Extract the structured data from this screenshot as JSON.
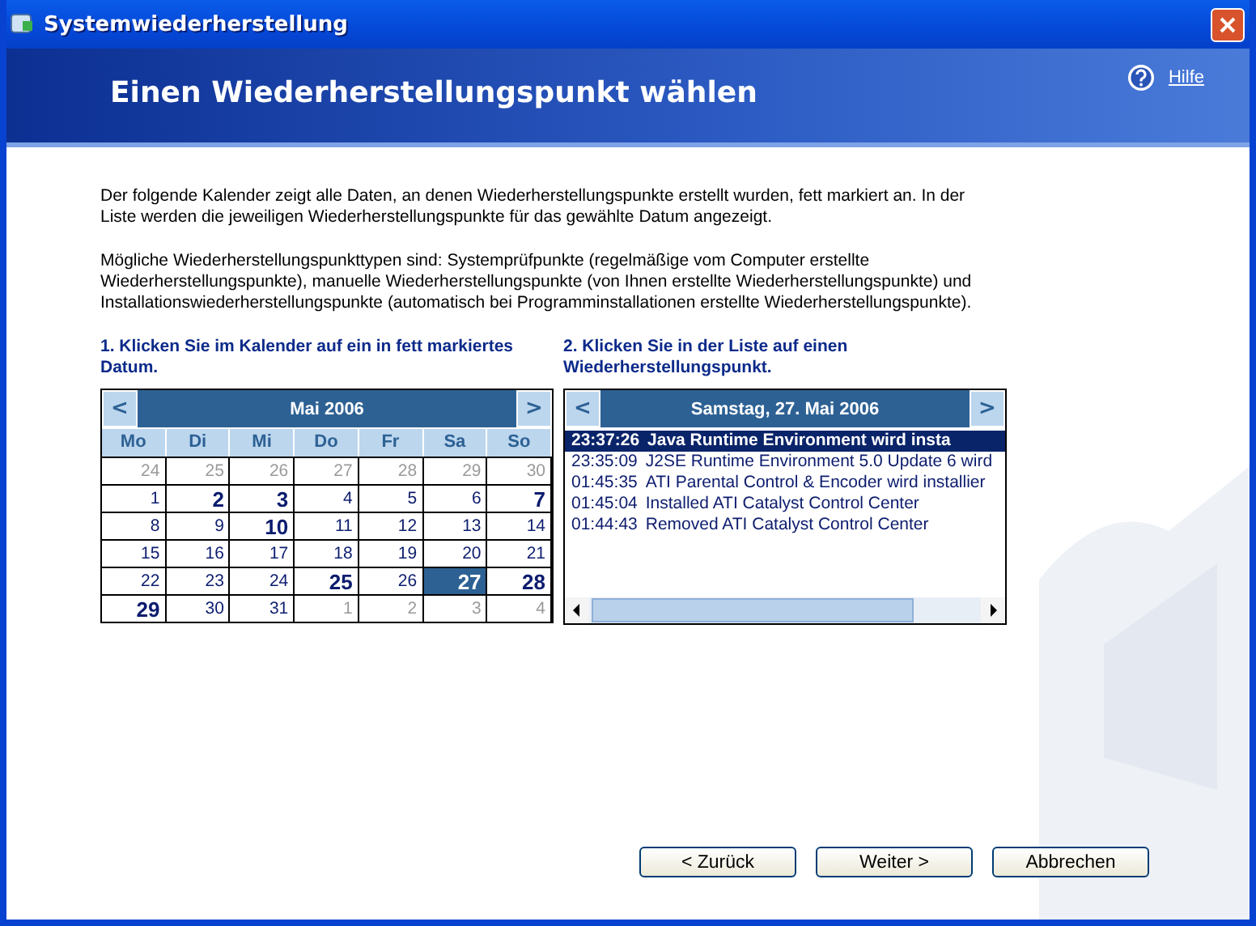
{
  "window": {
    "title": "Systemwiederherstellung"
  },
  "header": {
    "title": "Einen Wiederherstellungspunkt wählen",
    "help_link": "Hilfe"
  },
  "intro": [
    "Der folgende Kalender zeigt alle Daten, an denen Wiederherstellungspunkte erstellt wurden, fett markiert an. In der Liste werden die jeweiligen Wiederherstellungspunkte für das gewählte Datum angezeigt.",
    "Mögliche Wiederherstellungspunkttypen sind: Systemprüfpunkte (regelmäßige vom Computer erstellte Wiederherstellungspunkte), manuelle Wiederherstellungspunkte (von Ihnen erstellte Wiederherstellungspunkte) und Installationswiederherstellungspunkte (automatisch bei Programminstallationen erstellte Wiederherstellungspunkte)."
  ],
  "calendar": {
    "step": "1. Klicken Sie im Kalender auf ein in fett markiertes Datum.",
    "prev": "<",
    "next": ">",
    "month": "Mai 2006",
    "weekdays": [
      "Mo",
      "Di",
      "Mi",
      "Do",
      "Fr",
      "Sa",
      "So"
    ],
    "weeks": [
      [
        {
          "day": "24",
          "other_month": true,
          "bold": false,
          "selected": false
        },
        {
          "day": "25",
          "other_month": true,
          "bold": false,
          "selected": false
        },
        {
          "day": "26",
          "other_month": true,
          "bold": false,
          "selected": false
        },
        {
          "day": "27",
          "other_month": true,
          "bold": false,
          "selected": false
        },
        {
          "day": "28",
          "other_month": true,
          "bold": false,
          "selected": false
        },
        {
          "day": "29",
          "other_month": true,
          "bold": false,
          "selected": false
        },
        {
          "day": "30",
          "other_month": true,
          "bold": false,
          "selected": false
        }
      ],
      [
        {
          "day": "1",
          "other_month": false,
          "bold": false,
          "selected": false
        },
        {
          "day": "2",
          "other_month": false,
          "bold": true,
          "selected": false
        },
        {
          "day": "3",
          "other_month": false,
          "bold": true,
          "selected": false
        },
        {
          "day": "4",
          "other_month": false,
          "bold": false,
          "selected": false
        },
        {
          "day": "5",
          "other_month": false,
          "bold": false,
          "selected": false
        },
        {
          "day": "6",
          "other_month": false,
          "bold": false,
          "selected": false
        },
        {
          "day": "7",
          "other_month": false,
          "bold": true,
          "selected": false
        }
      ],
      [
        {
          "day": "8",
          "other_month": false,
          "bold": false,
          "selected": false
        },
        {
          "day": "9",
          "other_month": false,
          "bold": false,
          "selected": false
        },
        {
          "day": "10",
          "other_month": false,
          "bold": true,
          "selected": false
        },
        {
          "day": "11",
          "other_month": false,
          "bold": false,
          "selected": false
        },
        {
          "day": "12",
          "other_month": false,
          "bold": false,
          "selected": false
        },
        {
          "day": "13",
          "other_month": false,
          "bold": false,
          "selected": false
        },
        {
          "day": "14",
          "other_month": false,
          "bold": false,
          "selected": false
        }
      ],
      [
        {
          "day": "15",
          "other_month": false,
          "bold": false,
          "selected": false
        },
        {
          "day": "16",
          "other_month": false,
          "bold": false,
          "selected": false
        },
        {
          "day": "17",
          "other_month": false,
          "bold": false,
          "selected": false
        },
        {
          "day": "18",
          "other_month": false,
          "bold": false,
          "selected": false
        },
        {
          "day": "19",
          "other_month": false,
          "bold": false,
          "selected": false
        },
        {
          "day": "20",
          "other_month": false,
          "bold": false,
          "selected": false
        },
        {
          "day": "21",
          "other_month": false,
          "bold": false,
          "selected": false
        }
      ],
      [
        {
          "day": "22",
          "other_month": false,
          "bold": false,
          "selected": false
        },
        {
          "day": "23",
          "other_month": false,
          "bold": false,
          "selected": false
        },
        {
          "day": "24",
          "other_month": false,
          "bold": false,
          "selected": false
        },
        {
          "day": "25",
          "other_month": false,
          "bold": true,
          "selected": false
        },
        {
          "day": "26",
          "other_month": false,
          "bold": false,
          "selected": false
        },
        {
          "day": "27",
          "other_month": false,
          "bold": true,
          "selected": true
        },
        {
          "day": "28",
          "other_month": false,
          "bold": true,
          "selected": false
        }
      ],
      [
        {
          "day": "29",
          "other_month": false,
          "bold": true,
          "selected": false
        },
        {
          "day": "30",
          "other_month": false,
          "bold": false,
          "selected": false
        },
        {
          "day": "31",
          "other_month": false,
          "bold": false,
          "selected": false
        },
        {
          "day": "1",
          "other_month": true,
          "bold": false,
          "selected": false
        },
        {
          "day": "2",
          "other_month": true,
          "bold": false,
          "selected": false
        },
        {
          "day": "3",
          "other_month": true,
          "bold": false,
          "selected": false
        },
        {
          "day": "4",
          "other_month": true,
          "bold": false,
          "selected": false
        }
      ]
    ]
  },
  "restore_points": {
    "step": "2. Klicken Sie in der Liste auf einen Wiederherstellungspunkt.",
    "prev": "<",
    "next": ">",
    "date": "Samstag, 27. Mai 2006",
    "items": [
      {
        "time": "23:37:26",
        "description": "Java Runtime Environment wird insta",
        "selected": true
      },
      {
        "time": "23:35:09",
        "description": "J2SE Runtime Environment 5.0 Update 6 wird",
        "selected": false
      },
      {
        "time": "01:45:35",
        "description": "ATI Parental Control & Encoder wird installier",
        "selected": false
      },
      {
        "time": "01:45:04",
        "description": "Installed ATI Catalyst Control Center",
        "selected": false
      },
      {
        "time": "01:44:43",
        "description": "Removed ATI Catalyst Control Center",
        "selected": false
      }
    ]
  },
  "buttons": [
    {
      "label": "< Zurück"
    },
    {
      "label": "Weiter >"
    },
    {
      "label": "Abbrechen"
    }
  ]
}
